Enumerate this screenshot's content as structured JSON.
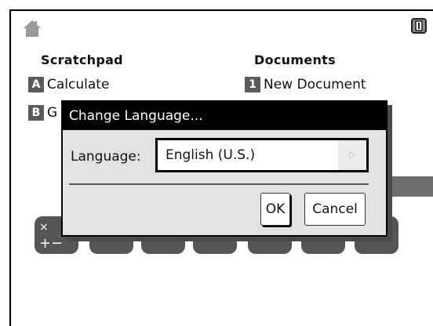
{
  "headings": {
    "scratchpad": "Scratchpad",
    "documents": "Documents"
  },
  "scratchpad_items": [
    {
      "key": "A",
      "label": "Calculate"
    },
    {
      "key": "B",
      "label": "G"
    }
  ],
  "documents_items": [
    {
      "key": "1",
      "label": "New Document"
    }
  ],
  "dialog": {
    "title": "Change Language...",
    "language_label": "Language:",
    "language_value": "English (U.S.)",
    "ok_label": "OK",
    "cancel_label": "Cancel"
  },
  "icons": {
    "home": "home-icon",
    "battery": "battery-icon",
    "dropdown": "dropdown-arrow-icon"
  },
  "colors": {
    "title_bar": "#000000",
    "dialog_bg": "#e2e2e2",
    "key_badge": "#5b5b5b"
  }
}
